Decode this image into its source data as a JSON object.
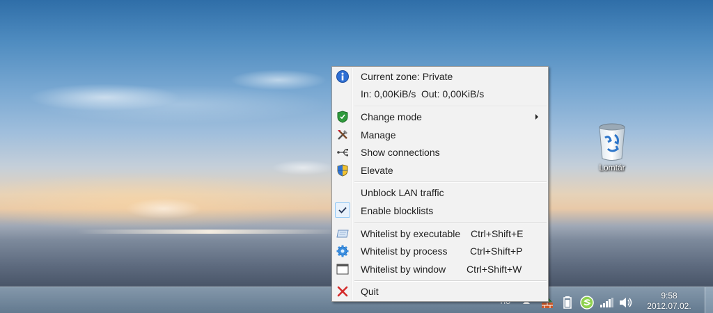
{
  "desktop": {
    "recycle_bin_label": "Lomtár"
  },
  "menu": {
    "zone_label": "Current zone: Private",
    "traffic_in": "In: 0,00KiB/s",
    "traffic_out": "Out: 0,00KiB/s",
    "items": [
      {
        "label": "Change mode",
        "icon": "shield-icon",
        "has_submenu": true
      },
      {
        "label": "Manage",
        "icon": "tools-icon"
      },
      {
        "label": "Show connections",
        "icon": "network-icon"
      },
      {
        "label": "Elevate",
        "icon": "uac-shield-icon"
      },
      {
        "label": "Unblock LAN traffic"
      },
      {
        "label": "Enable blocklists",
        "checked": true
      },
      {
        "label": "Whitelist by executable",
        "shortcut": "Ctrl+Shift+E",
        "icon": "executable-icon"
      },
      {
        "label": "Whitelist by process",
        "shortcut": "Ctrl+Shift+P",
        "icon": "gear-icon"
      },
      {
        "label": "Whitelist by window",
        "shortcut": "Ctrl+Shift+W",
        "icon": "window-icon"
      },
      {
        "label": "Quit",
        "icon": "close-icon"
      }
    ]
  },
  "taskbar": {
    "language": "HU",
    "clock_time": "9:58",
    "clock_date": "2012.07.02."
  },
  "colors": {
    "menu_background": "#f2f2f2",
    "info_icon": "#2e6fd4",
    "quit_icon": "#d42a2a",
    "check_highlight": "#e8f2fc"
  }
}
